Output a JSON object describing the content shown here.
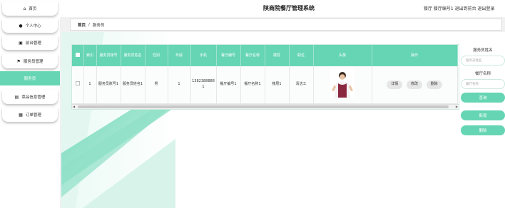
{
  "app": {
    "title": "陕商院餐厅管理系统",
    "user_info": "餐厅 餐厅编号1  退出到前台  退出登录"
  },
  "sidebar": {
    "items": [
      {
        "label": "首页",
        "icon": "home-icon"
      },
      {
        "label": "个人中心",
        "icon": "user-icon"
      },
      {
        "label": "前台管理",
        "icon": "clipboard-icon"
      },
      {
        "label": "服务员管理",
        "icon": "flag-icon"
      },
      {
        "label": "服务员",
        "icon": ""
      },
      {
        "label": "菜品信息管理",
        "icon": "chart-icon"
      },
      {
        "label": "订单管理",
        "icon": "grid-icon"
      }
    ]
  },
  "breadcrumb": {
    "home": "首页",
    "separator": "/",
    "current": "服务员"
  },
  "table": {
    "headers": [
      "索引",
      "服务员账号",
      "服务员姓名",
      "性别",
      "年龄",
      "手机",
      "餐厅编号",
      "餐厅名称",
      "楼层",
      "职位",
      "头像",
      "操作"
    ],
    "rows": [
      {
        "index": "1",
        "account": "服务员账号1",
        "name": "服务员姓名1",
        "gender": "男",
        "age": "1",
        "phone": "13823888881",
        "restaurant_no": "餐厅编号1",
        "restaurant_name": "餐厅名称1",
        "floor": "楼层1",
        "position": "清洁工",
        "actions": {
          "detail": "详情",
          "edit": "修改",
          "delete": "删除"
        }
      }
    ]
  },
  "search": {
    "name_label": "服务员姓名",
    "name_placeholder": "服务员姓名",
    "restaurant_label": "餐厅名称",
    "restaurant_placeholder": "餐厅名称",
    "search_button": "查询",
    "add_button": "新增",
    "delete_button": "删除"
  },
  "colors": {
    "accent": "#66d5b3",
    "background": "#f1f1f1"
  }
}
